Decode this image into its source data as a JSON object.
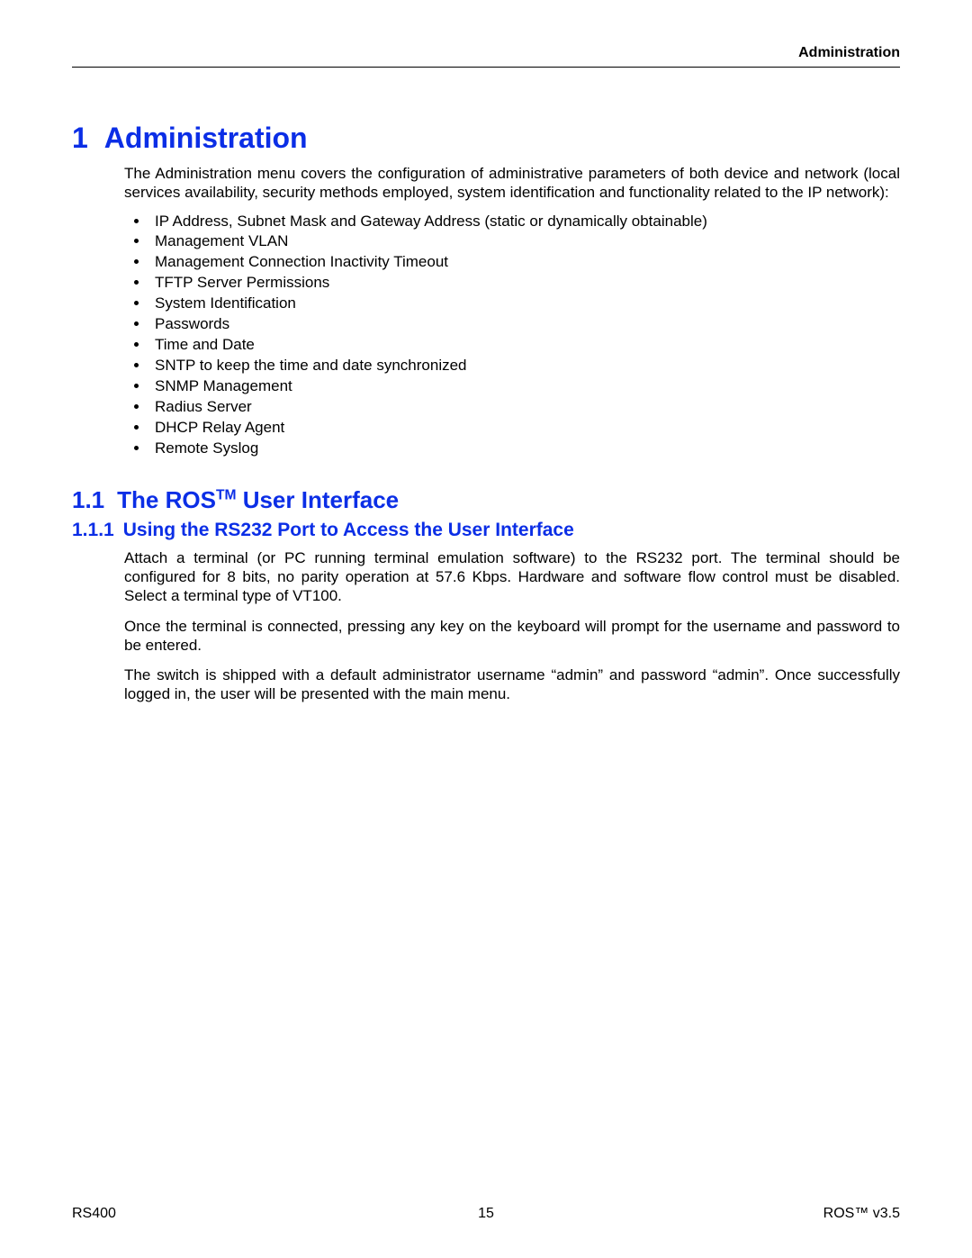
{
  "header": {
    "section": "Administration"
  },
  "h1": {
    "number": "1",
    "title": "Administration"
  },
  "intro": "The Administration menu covers the configuration of administrative parameters of both device and network (local services availability, security methods employed, system identification and functionality related to the IP network):",
  "bullets": [
    "IP Address, Subnet Mask and Gateway Address (static or dynamically obtainable)",
    "Management VLAN",
    "Management Connection Inactivity Timeout",
    "TFTP Server Permissions",
    "System Identification",
    "Passwords",
    "Time and Date",
    "SNTP to keep the time and date synchronized",
    "SNMP Management",
    "Radius Server",
    "DHCP Relay Agent",
    "Remote Syslog"
  ],
  "h2": {
    "number": "1.1",
    "title_pre": "The ROS",
    "tm": "TM",
    "title_post": " User Interface"
  },
  "h3": {
    "number": "1.1.1",
    "title": "Using the RS232 Port to Access the User Interface"
  },
  "paragraphs": {
    "p1": "Attach a terminal (or PC running terminal emulation software) to the RS232 port. The terminal should be configured for 8 bits, no parity operation at 57.6 Kbps. Hardware and software flow control must be disabled. Select a terminal type of VT100.",
    "p2": "Once the terminal is connected, pressing any key on the keyboard will prompt for the username and password to be entered.",
    "p3": "The switch is shipped with a default administrator username “admin” and password “admin”. Once successfully logged in, the user will be presented with the main menu."
  },
  "footer": {
    "left": "RS400",
    "center": "15",
    "right_pre": "ROS",
    "right_tm": "™",
    "right_post": "  v3.5"
  }
}
